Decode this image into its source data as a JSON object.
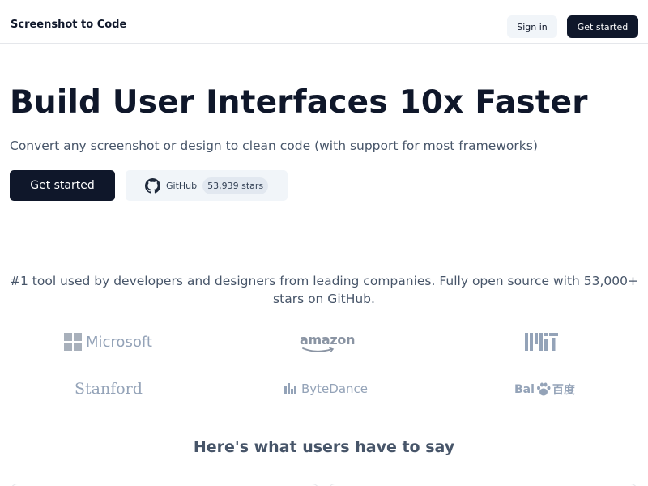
{
  "header": {
    "brand": "Screenshot to Code",
    "signin_label": "Sign in",
    "cta_label": "Get started"
  },
  "hero": {
    "title": "Build User Interfaces 10x Faster",
    "subtitle": "Convert any screenshot or design to clean code (with support for most frameworks)",
    "cta_label": "Get started",
    "github_label": "GitHub",
    "github_stars": "53,939 stars"
  },
  "social_proof": {
    "text": "#1 tool used by developers and designers from leading companies. Fully open source with 53,000+ stars on GitHub."
  },
  "logos": {
    "microsoft": "Microsoft",
    "amazon": "amazon",
    "mit": "MIT",
    "stanford": "Stanford",
    "bytedance": "ByteDance",
    "baidu_left": "Bai",
    "baidu_right": "百度"
  },
  "testimonials": {
    "heading": "Here's what users have to say"
  },
  "colors": {
    "primary": "#0f172a",
    "secondary_bg": "#f1f5f9",
    "muted_text": "#475569",
    "logo_gray": "#94a3b8"
  },
  "icons": {
    "github": "github-icon"
  }
}
